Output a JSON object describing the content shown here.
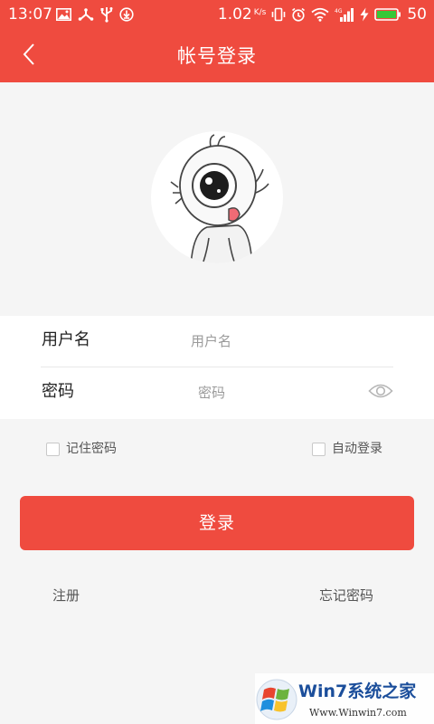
{
  "status_bar": {
    "time": "13:07",
    "speed": "1.02",
    "speed_unit": "K/s",
    "signal_label": "4G",
    "battery": "50",
    "icons": [
      "image-icon",
      "share-icon",
      "usb-icon",
      "download-icon",
      "vibrate-icon",
      "alarm-icon",
      "wifi-icon",
      "signal-icon",
      "charging-icon",
      "battery-icon"
    ]
  },
  "header": {
    "title": "帐号登录",
    "back_icon": "chevron-left-icon"
  },
  "avatar": {
    "icon": "cartoon-eyeball-avatar"
  },
  "form": {
    "username": {
      "label": "用户名",
      "placeholder": "用户名",
      "value": ""
    },
    "password": {
      "label": "密码",
      "placeholder": "密码",
      "value": "",
      "toggle_icon": "eye-icon"
    }
  },
  "options": {
    "remember_password": {
      "label": "记住密码",
      "checked": false
    },
    "auto_login": {
      "label": "自动登录",
      "checked": false
    }
  },
  "login_button": {
    "label": "登录"
  },
  "links": {
    "register": "注册",
    "forgot_password": "忘记密码"
  },
  "watermark": {
    "text": "Win7系统之家",
    "url": "Www.Winwin7.com"
  },
  "colors": {
    "accent": "#ef4b3f",
    "page_background": "#f5f5f5",
    "card_background": "#ffffff"
  }
}
